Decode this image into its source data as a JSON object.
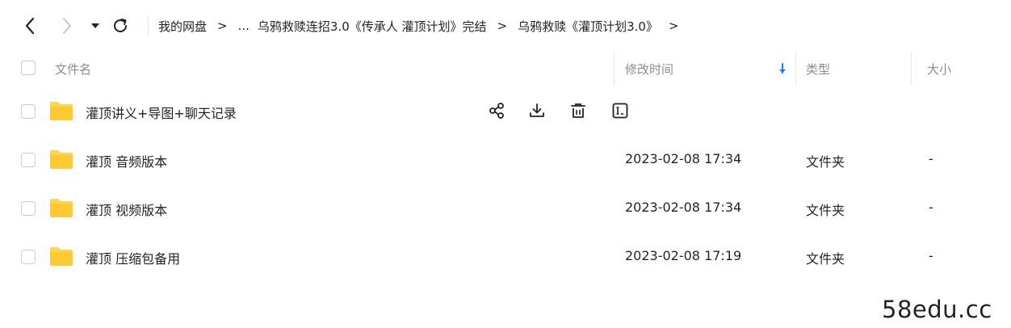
{
  "nav": {
    "back_icon": "chevron-left-icon",
    "forward_icon": "chevron-right-icon",
    "dropdown_icon": "caret-down-icon",
    "refresh_icon": "refresh-icon"
  },
  "breadcrumb": {
    "items": [
      "我的网盘",
      "乌鸦救赎连招3.0《传承人 灌顶计划》完结",
      "乌鸦救赎《灌顶计划3.0》"
    ],
    "ellipsis": "...",
    "separator": ">"
  },
  "table": {
    "columns": {
      "name": "文件名",
      "mtime": "修改时间",
      "type": "类型",
      "size": "大小"
    },
    "sort_icon": "arrow-down-icon",
    "sort_color": "#1677ff",
    "rows": [
      {
        "name": "灌顶讲义+导图+聊天记录",
        "mtime": "",
        "type": "",
        "size": ""
      },
      {
        "name": "灌顶 音频版本",
        "mtime": "2023-02-08 17:34",
        "type": "文件夹",
        "size": "-"
      },
      {
        "name": "灌顶 视频版本",
        "mtime": "2023-02-08 17:34",
        "type": "文件夹",
        "size": "-"
      },
      {
        "name": "灌顶 压缩包备用",
        "mtime": "2023-02-08 17:19",
        "type": "文件夹",
        "size": "-"
      }
    ],
    "row_actions": [
      "share-icon",
      "download-icon",
      "delete-icon",
      "rename-icon"
    ],
    "folder_icon": "folder-icon",
    "folder_color": "#ffd44f"
  },
  "watermark": "58edu.cc"
}
